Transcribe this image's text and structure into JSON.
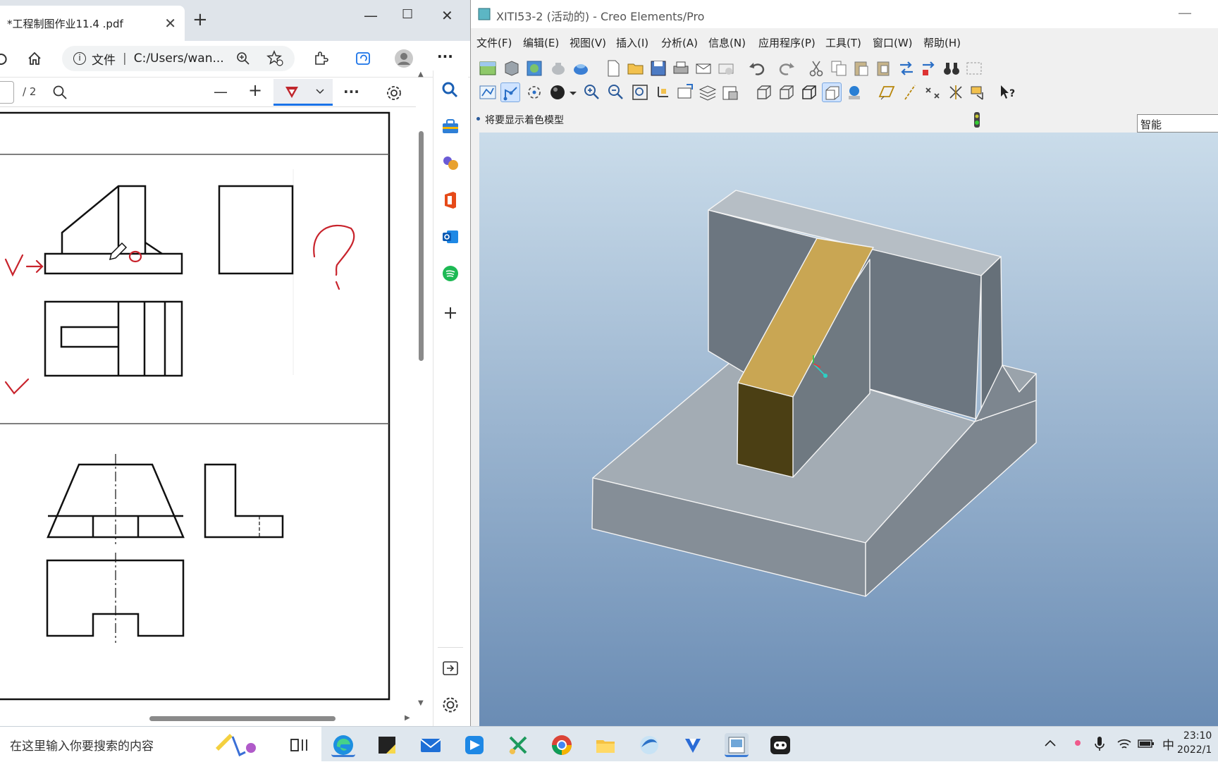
{
  "edge": {
    "tab_title": "*工程制图作业11.4 .pdf",
    "tab_close": "✕",
    "new_tab": "+",
    "address_info": "文件",
    "address_sep": "|",
    "address_url": "C:/Users/wan...",
    "page_total": "/ 2",
    "more": "···",
    "zoom_out": "—",
    "zoom_in": "+"
  },
  "drawing": {
    "annotation_check_1": "✓",
    "annotation_question": "?",
    "annotation_check_2": "✓"
  },
  "creo": {
    "title": "XITI53-2 (活动的) - Creo Elements/Pro",
    "menu": [
      "文件(F)",
      "编辑(E)",
      "视图(V)",
      "插入(I)",
      "分析(A)",
      "信息(N)",
      "应用程序(P)",
      "工具(T)",
      "窗口(W)",
      "帮助(H)"
    ],
    "message": "将要显示着色模型",
    "filter_value": "智能",
    "colors": {
      "viewport_top": "#c9dcea",
      "viewport_bottom": "#6f8fb5",
      "face_gray": "#9aa3ab",
      "face_dark": "#6e7780",
      "rib_top": "#c8a552",
      "rib_front": "#4c3f14"
    }
  },
  "taskbar": {
    "search_placeholder": "在这里输入你要搜索的内容",
    "ime": "中",
    "time": "23:10",
    "date": "2022/1"
  }
}
